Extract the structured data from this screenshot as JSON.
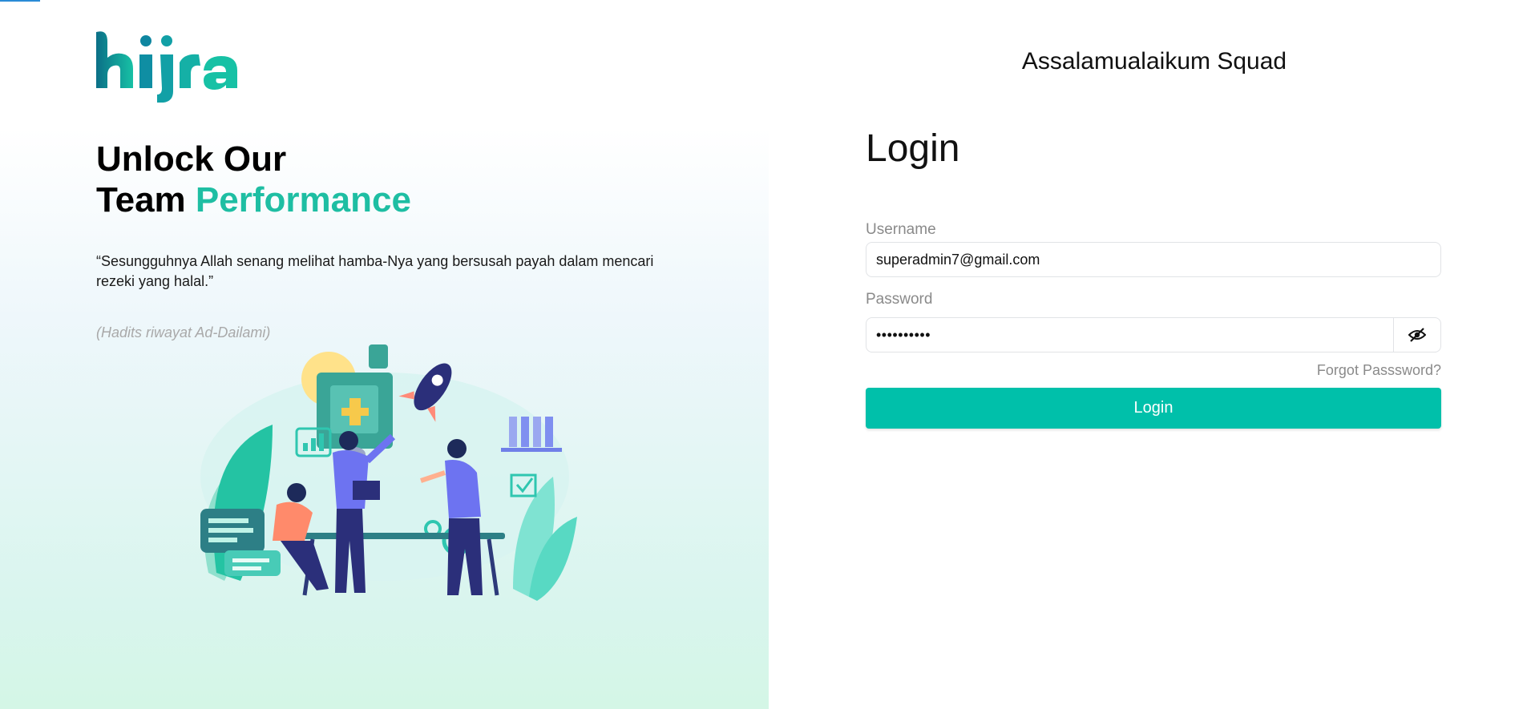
{
  "brand": {
    "logo_text": "hijra",
    "logo_color_dark": "#0b6f87",
    "logo_color_light": "#17c1a5"
  },
  "hero": {
    "headline_line1": "Unlock Our",
    "headline_line2_prefix": "Team",
    "headline_line2_accent": "Performance",
    "accent_color": "#1ebea3",
    "quote": "“Sesungguhnya Allah senang melihat hamba-Nya yang bersusah payah dalam mencari rezeki yang halal.”",
    "source": "(Hadits riwayat Ad-Dailami)"
  },
  "login": {
    "greeting": "Assalamualaikum Squad",
    "title": "Login",
    "username_label": "Username",
    "username_value": "superadmin7@gmail.com",
    "password_label": "Password",
    "password_masked": "••••••••••",
    "toggle_icon": "eye-slash-icon",
    "forgot_password": "Forgot Passsword?",
    "submit_label": "Login",
    "button_color": "#00c0aa"
  }
}
